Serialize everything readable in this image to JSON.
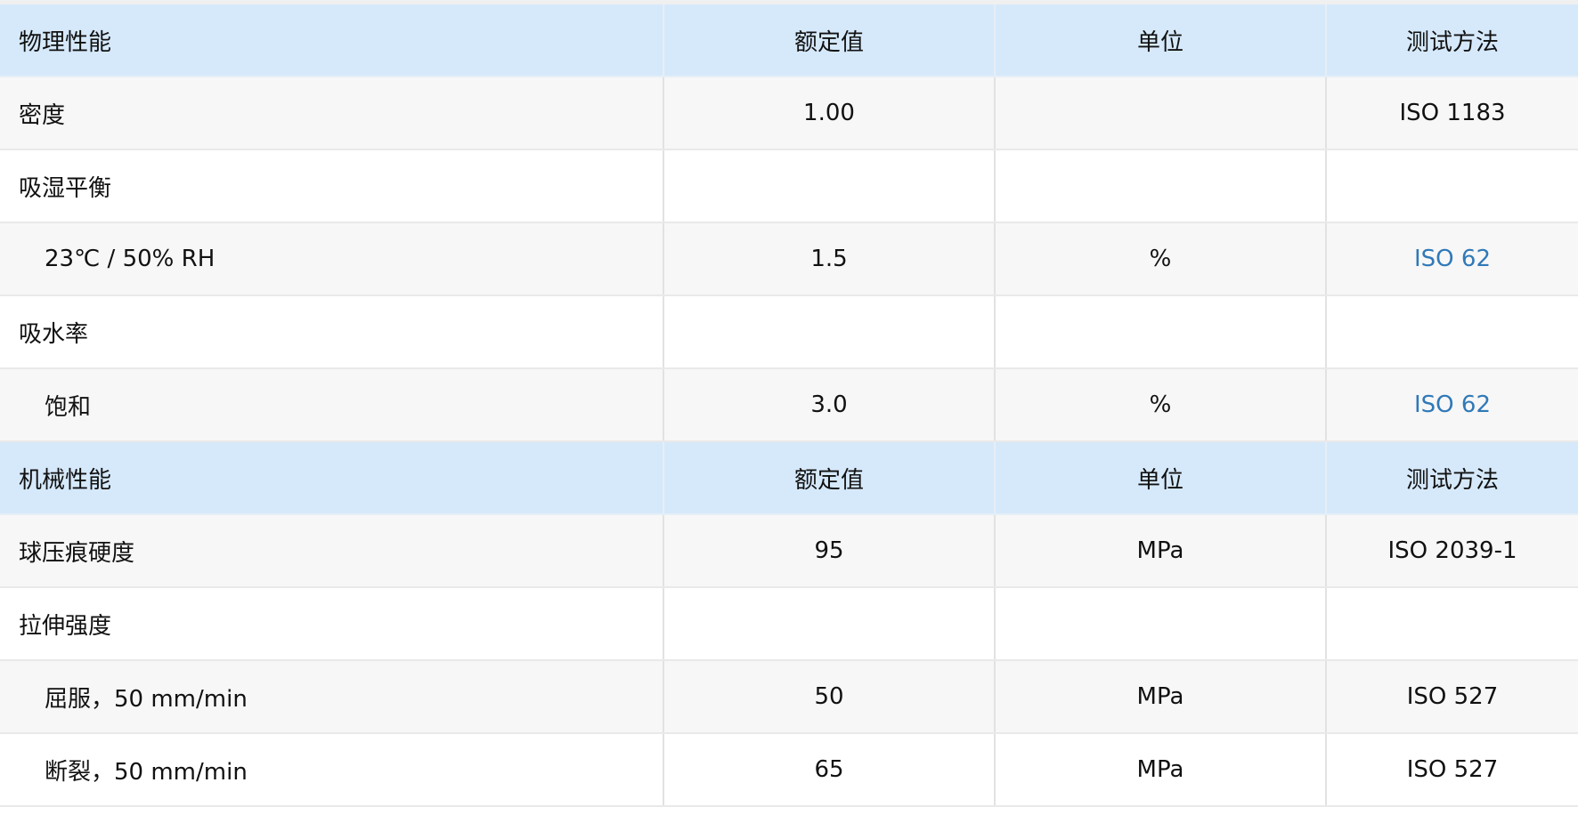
{
  "sections": {
    "physical": {
      "header": {
        "property": "物理性能",
        "value": "额定值",
        "unit": "单位",
        "method": "测试方法"
      },
      "rows": {
        "density": {
          "property": "密度",
          "value": "1.00",
          "unit": "",
          "method": "ISO 1183"
        },
        "moisture_eq": {
          "property": "吸湿平衡",
          "value": "",
          "unit": "",
          "method": ""
        },
        "moisture_23": {
          "property": "23℃ / 50% RH",
          "value": "1.5",
          "unit": "%",
          "method": "ISO 62"
        },
        "water_abs": {
          "property": "吸水率",
          "value": "",
          "unit": "",
          "method": ""
        },
        "saturation": {
          "property": "饱和",
          "value": "3.0",
          "unit": "%",
          "method": "ISO 62"
        }
      }
    },
    "mechanical": {
      "header": {
        "property": "机械性能",
        "value": "额定值",
        "unit": "单位",
        "method": "测试方法"
      },
      "rows": {
        "ball_hardness": {
          "property": "球压痕硬度",
          "value": "95",
          "unit": "MPa",
          "method": "ISO 2039-1"
        },
        "tensile": {
          "property": "拉伸强度",
          "value": "",
          "unit": "",
          "method": ""
        },
        "yield": {
          "property": "屈服，50 mm/min",
          "value": "50",
          "unit": "MPa",
          "method": "ISO 527"
        },
        "break": {
          "property": "断裂，50 mm/min",
          "value": "65",
          "unit": "MPa",
          "method": "ISO 527"
        }
      }
    }
  },
  "colors": {
    "header_bg": "#d6e9fb",
    "row_gray": "#f7f7f7",
    "link": "#3079b8"
  }
}
